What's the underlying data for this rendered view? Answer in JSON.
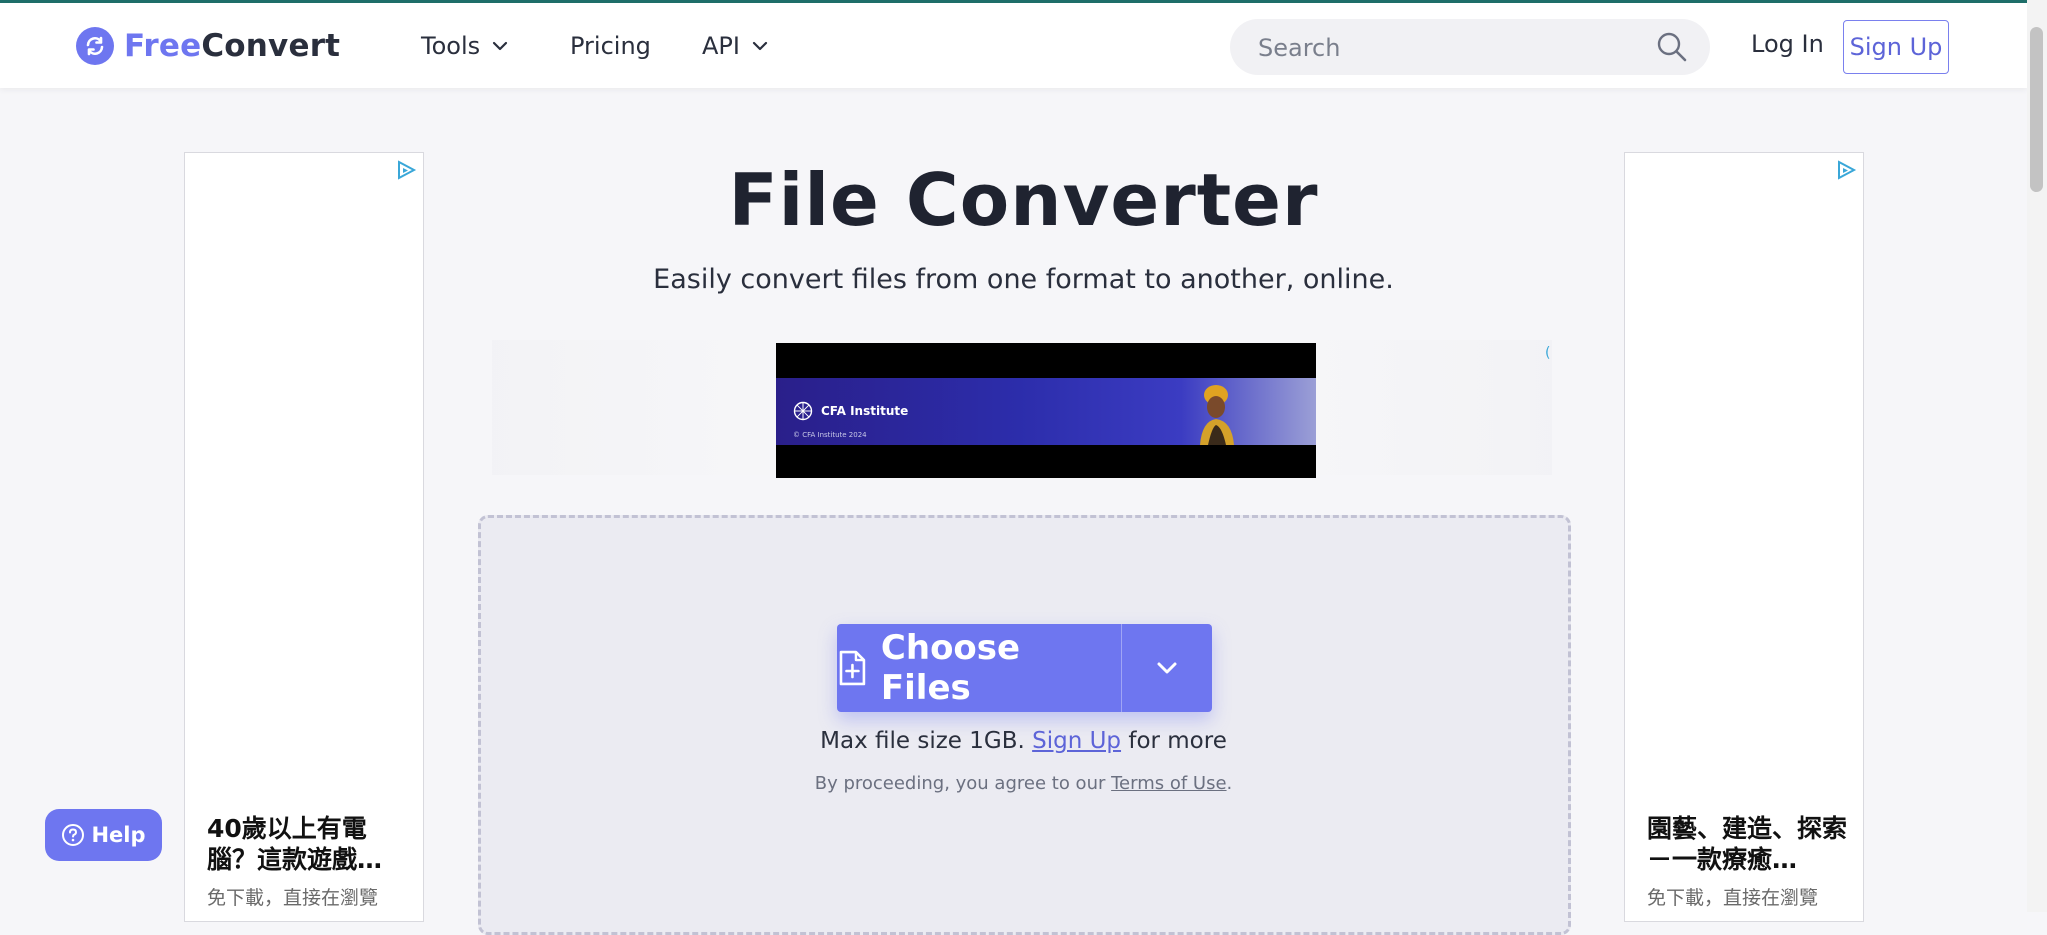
{
  "header": {
    "logo_free": "Free",
    "logo_convert": "Convert",
    "nav": {
      "tools": "Tools",
      "pricing": "Pricing",
      "api": "API"
    },
    "search_placeholder": "Search",
    "login": "Log In",
    "signup": "Sign Up"
  },
  "main": {
    "title": "File Converter",
    "subtitle": "Easily convert files from one format to another, online.",
    "choose_files": "Choose Files",
    "max_size_prefix": "Max file size 1GB. ",
    "max_size_link": "Sign Up",
    "max_size_suffix": " for more",
    "terms_prefix": "By proceeding, you agree to our ",
    "terms_link": "Terms of Use",
    "terms_suffix": "."
  },
  "banner_ad": {
    "brand": "CFA Institute",
    "copyright": "© CFA Institute 2024"
  },
  "ads": {
    "left_title": "40歲以上有電腦？這款遊戲…",
    "left_sub": "免下載，直接在瀏覽",
    "right_title": "園藝、建造、探索－一款療癒…",
    "right_sub": "免下載，直接在瀏覽"
  },
  "help": "Help",
  "colors": {
    "accent": "#6e76f0",
    "text": "#1f2330",
    "link": "#5d64d8"
  }
}
